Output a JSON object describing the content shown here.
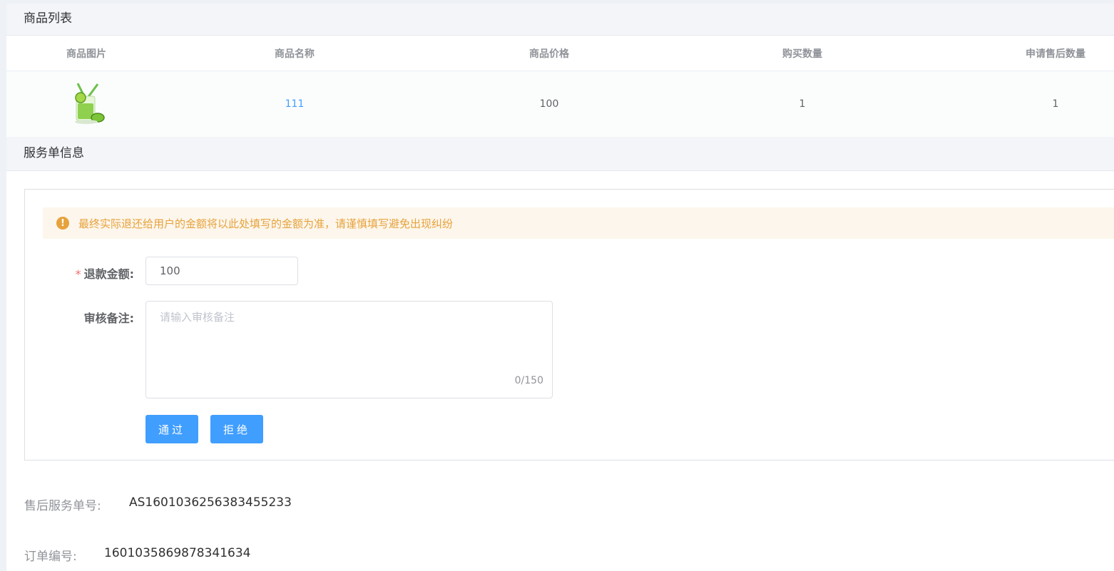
{
  "sections": {
    "product_list_title": "商品列表",
    "service_info_title": "服务单信息"
  },
  "table": {
    "headers": [
      "商品图片",
      "商品名称",
      "商品价格",
      "购买数量",
      "申请售后数量"
    ],
    "rows": [
      {
        "image": "drink-image",
        "name": "111",
        "price": "100",
        "quantity": "1",
        "after_sale_quantity": "1"
      }
    ]
  },
  "form": {
    "alert_text": "最终实际退还给用户的金额将以此处填写的金额为准，请谨慎填写避免出现纠纷",
    "alert_icon": "warning-icon",
    "required_mark": "*",
    "refund_label": "退款金额:",
    "refund_value": "100",
    "remark_label": "审核备注:",
    "remark_placeholder": "请输入审核备注",
    "remark_counter": "0/150",
    "approve_label": "通过",
    "reject_label": "拒绝"
  },
  "info": {
    "service_no_label": "售后服务单号:",
    "service_no_value": "AS1601036256383455233",
    "order_no_label": "订单编号:",
    "order_no_value": "1601035869878341634"
  },
  "colors": {
    "primary": "#409eff",
    "warning": "#e6a23c",
    "danger": "#f56c6c"
  }
}
